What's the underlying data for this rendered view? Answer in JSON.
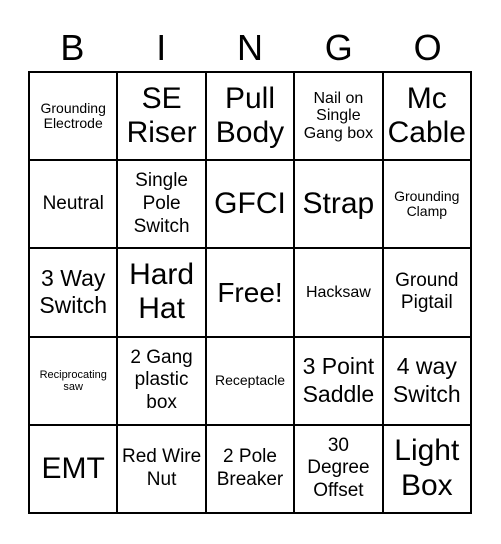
{
  "title_letters": [
    "B",
    "I",
    "N",
    "G",
    "O"
  ],
  "cells": [
    {
      "text": "Grounding Electrode",
      "size": "s-sm"
    },
    {
      "text": "SE Riser",
      "size": "s-huge"
    },
    {
      "text": "Pull Body",
      "size": "s-huge"
    },
    {
      "text": "Nail on Single Gang box",
      "size": "s-md"
    },
    {
      "text": "Mc Cable",
      "size": "s-huge"
    },
    {
      "text": "Neutral",
      "size": "s-lg"
    },
    {
      "text": "Single Pole Switch",
      "size": "s-lg"
    },
    {
      "text": "GFCI",
      "size": "s-huge"
    },
    {
      "text": "Strap",
      "size": "s-huge"
    },
    {
      "text": "Grounding Clamp",
      "size": "s-sm"
    },
    {
      "text": "3 Way Switch",
      "size": "s-xl"
    },
    {
      "text": "Hard Hat",
      "size": "s-huge"
    },
    {
      "text": "Free!",
      "size": "s-xxl"
    },
    {
      "text": "Hacksaw",
      "size": "s-md"
    },
    {
      "text": "Ground Pigtail",
      "size": "s-lg"
    },
    {
      "text": "Reciprocating saw",
      "size": "s-xs"
    },
    {
      "text": "2 Gang plastic box",
      "size": "s-lg"
    },
    {
      "text": "Receptacle",
      "size": "s-sm"
    },
    {
      "text": "3 Point Saddle",
      "size": "s-xl"
    },
    {
      "text": "4 way Switch",
      "size": "s-xl"
    },
    {
      "text": "EMT",
      "size": "s-huge"
    },
    {
      "text": "Red Wire Nut",
      "size": "s-lg"
    },
    {
      "text": "2 Pole Breaker",
      "size": "s-lg"
    },
    {
      "text": "30 Degree Offset",
      "size": "s-lg"
    },
    {
      "text": "Light Box",
      "size": "s-huge"
    }
  ]
}
